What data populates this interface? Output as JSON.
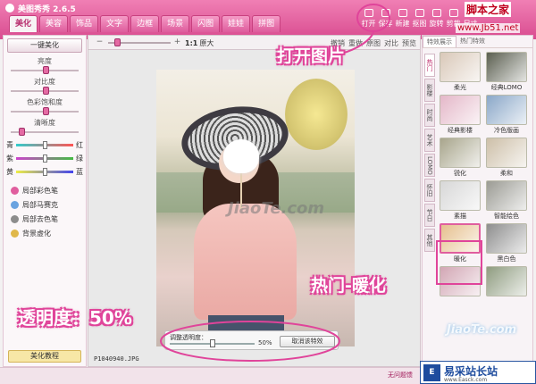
{
  "app": {
    "title": "美图秀秀 2.6.5"
  },
  "tabs": [
    {
      "label": "美化",
      "active": true
    },
    {
      "label": "美容",
      "active": false
    },
    {
      "label": "饰品",
      "active": false
    },
    {
      "label": "文字",
      "active": false
    },
    {
      "label": "边框",
      "active": false
    },
    {
      "label": "场景",
      "active": false
    },
    {
      "label": "闪图",
      "active": false
    },
    {
      "label": "娃娃",
      "active": false
    },
    {
      "label": "拼图",
      "active": false
    }
  ],
  "toolbar": [
    "打开",
    "保存",
    "新建",
    "抠图",
    "旋转",
    "剪裁",
    "尺寸"
  ],
  "site_watermark": {
    "title": "脚本之家",
    "url": "www.Jb51.net"
  },
  "left_panel": {
    "onekey": "一键美化",
    "sliders": [
      {
        "label": "亮度",
        "value": 0.5
      },
      {
        "label": "对比度",
        "value": 0.5
      },
      {
        "label": "色彩饱和度",
        "value": 0.5
      },
      {
        "label": "清晰度",
        "value": 0.12
      }
    ],
    "color_balance": [
      {
        "left": "青",
        "right": "红",
        "value": 0.5
      },
      {
        "left": "紫",
        "right": "绿",
        "value": 0.5
      },
      {
        "left": "黄",
        "right": "蓝",
        "value": 0.5
      }
    ],
    "tools": [
      "局部彩色笔",
      "局部马赛克",
      "局部去色笔",
      "背景虚化"
    ],
    "tutorial": "美化教程"
  },
  "canvas": {
    "zoom_ratio": "1:1",
    "zoom_label": "原大",
    "zoom_level": 0.1,
    "actions": [
      "撤销",
      "重做",
      "原图",
      "对比",
      "预览"
    ],
    "photo_watermark": "JiaoTe.com",
    "filename": "P1040940.JPG",
    "opacity_panel": {
      "label": "调整透明度：",
      "value": "50%",
      "level": 0.5,
      "cancel": "取消该特效"
    }
  },
  "right_panel": {
    "tabs": [
      "特效展示",
      "热门特效"
    ],
    "side_tabs": [
      "热门",
      "影楼",
      "时尚",
      "艺术",
      "LOMO",
      "怀旧",
      "节日",
      "其他"
    ],
    "effects": [
      {
        "label": "柔光",
        "color": "#d9c8b8"
      },
      {
        "label": "经典LOMO",
        "color": "#5b5f50"
      },
      {
        "label": "经典影楼",
        "color": "#e4b7c8"
      },
      {
        "label": "冷色版画",
        "color": "#8aa7c8"
      },
      {
        "label": "锐化",
        "color": "#a8a58c"
      },
      {
        "label": "柔和",
        "color": "#cdbfa8"
      },
      {
        "label": "素描",
        "color": "#d7d7d7"
      },
      {
        "label": "智能绘色",
        "color": "#9b9b94"
      },
      {
        "label": "暖化",
        "color": "#e6c08e",
        "selected": true
      },
      {
        "label": "黑白色",
        "color": "#8e8e8e"
      },
      {
        "label": "",
        "color": "#d2a6b4"
      },
      {
        "label": "",
        "color": "#8f9c80"
      }
    ]
  },
  "annotations": {
    "open": "打开图片",
    "hot": "热门-暖化",
    "opacity": "透明度：50%"
  },
  "status": {
    "feedback": "无问题馈",
    "brand": "易采站长站",
    "brand_logo": "E",
    "brand_url": "www.Easck.com",
    "corner_wm": "JiaoTe.com"
  },
  "colors": {
    "accent": "#e0449a",
    "title_bar": "#d94c90"
  }
}
